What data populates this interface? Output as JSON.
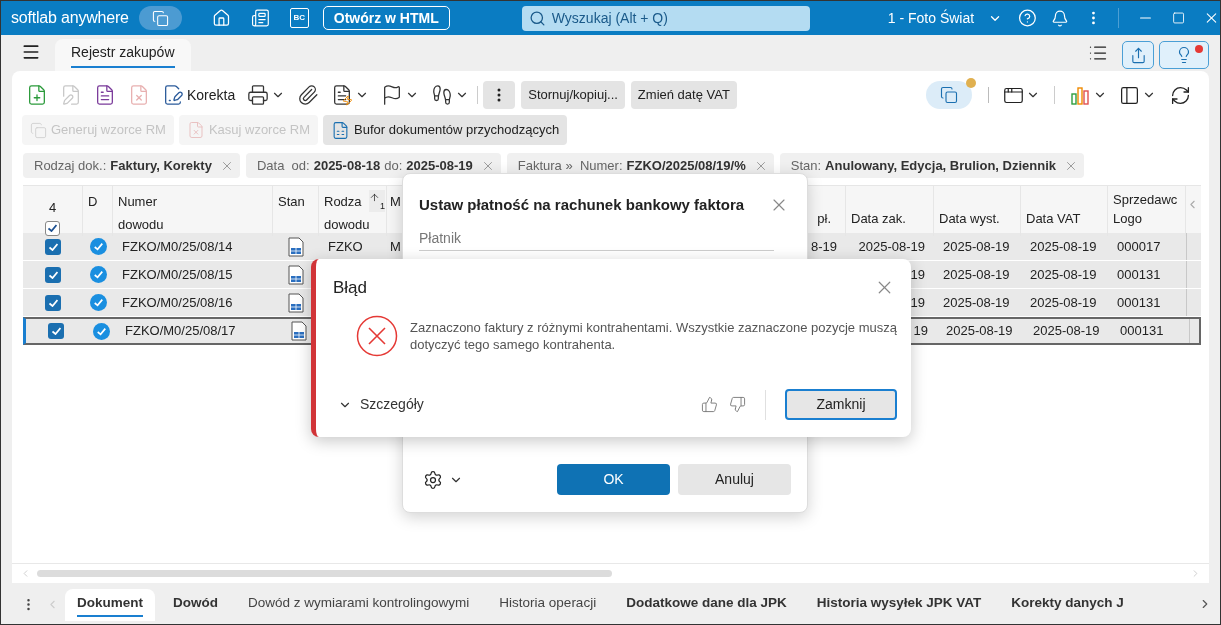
{
  "titlebar": {
    "brand": "softlab anywhere",
    "bc_badge": "BC",
    "open_html_button": "Otwórz w HTML",
    "search": {
      "placeholder": "Wyszukaj (Alt + Q)"
    },
    "company": "1 - Foto Świat"
  },
  "module_tabs": [
    {
      "label": "Rejestr zakupów",
      "selected": true
    }
  ],
  "toolbar": {
    "actions": [
      {
        "disabled": false,
        "dropdown": false
      },
      {
        "disabled": true,
        "dropdown": false
      },
      {
        "disabled": false,
        "dropdown": false
      },
      {
        "disabled": true,
        "dropdown": false
      },
      {
        "label": "Korekta",
        "disabled": false,
        "dropdown": false
      },
      {
        "disabled": false,
        "dropdown": true
      },
      {
        "disabled": false,
        "dropdown": false
      },
      {
        "disabled": false,
        "dropdown": true
      },
      {
        "disabled": false,
        "dropdown": true
      },
      {
        "disabled": false,
        "dropdown": true
      }
    ],
    "text_buttons": [
      "Stornuj/kopiuj...",
      "Zmień datę VAT"
    ],
    "secondary_buttons": [
      {
        "label": "Generuj wzorce RM",
        "disabled": true
      },
      {
        "label": "Kasuj wzorce RM",
        "disabled": true
      },
      {
        "label": "Bufor dokumentów przychodzących",
        "disabled": false
      }
    ]
  },
  "filters": [
    {
      "parts": [
        {
          "text": "Rodzaj dok.:",
          "bold": false
        },
        {
          "text": "Faktury, Korekty",
          "bold": true
        }
      ]
    },
    {
      "parts": [
        {
          "text": "Data  od:",
          "bold": false
        },
        {
          "text": "2025-08-18",
          "bold": true
        },
        {
          "text": "do:",
          "bold": false
        },
        {
          "text": "2025-08-19",
          "bold": true
        }
      ]
    },
    {
      "parts": [
        {
          "text": "Faktura »  Numer:",
          "bold": false
        },
        {
          "text": "FZKO/2025/08/19/%",
          "bold": true
        }
      ]
    },
    {
      "parts": [
        {
          "text": "Stan:",
          "bold": false
        },
        {
          "text": "Anulowany, Edycja, Brulion, Dziennik",
          "bold": true
        }
      ]
    }
  ],
  "table": {
    "selected_count": "4",
    "header_checked": true,
    "columns": [
      {
        "label": "D"
      },
      {
        "label": "Numer dowodu"
      },
      {
        "label": "Stan"
      },
      {
        "label": "Rodza dowodu",
        "sort_rank": "1"
      },
      {
        "label": "M"
      },
      {
        "label": "pł."
      },
      {
        "label": "Data zak."
      },
      {
        "label": "Data wyst."
      },
      {
        "label": "Data VAT"
      },
      {
        "label": "Logo",
        "group": "Sprzedawc"
      }
    ],
    "rows": [
      {
        "checked": true,
        "approved": true,
        "focused": false,
        "number": "FZKO/M0/25/08/14",
        "type": "FZKO",
        "column_6": "M",
        "column_7": "8-19",
        "purchase_date": "2025-08-19",
        "issue_date": "2025-08-19",
        "vat_date": "2025-08-19",
        "logo": "000017"
      },
      {
        "checked": true,
        "approved": true,
        "focused": false,
        "number": "FZKO/M0/25/08/15",
        "purchase_date": "19",
        "issue_date": "2025-08-19",
        "vat_date": "2025-08-19",
        "logo": "000131"
      },
      {
        "checked": true,
        "approved": true,
        "focused": false,
        "number": "FZKO/M0/25/08/16",
        "purchase_date": "19",
        "issue_date": "2025-08-19",
        "vat_date": "2025-08-19",
        "logo": "000131"
      },
      {
        "checked": true,
        "approved": true,
        "focused": true,
        "number": "FZKO/M0/25/08/17",
        "purchase_date": "19",
        "issue_date": "2025-08-19",
        "vat_date": "2025-08-19",
        "logo": "000131"
      }
    ]
  },
  "payment_dialog": {
    "title": "Ustaw płatność na rachunek bankowy faktora",
    "payer_field": {
      "placeholder": "Płatnik"
    },
    "ok_button": "OK",
    "cancel_button": "Anuluj"
  },
  "error_dialog": {
    "title": "Błąd",
    "message": "Zaznaczono faktury z różnymi kontrahentami. Wszystkie zaznaczone pozycje muszą dotyczyć tego samego kontrahenta.",
    "details_label": "Szczegóły",
    "close_button": "Zamknij"
  },
  "bottom_tabs": [
    {
      "label": "Dokument",
      "selected": true,
      "bold": true
    },
    {
      "label": "Dowód",
      "selected": false,
      "bold": true
    },
    {
      "label": "Dowód z wymiarami kontrolingowymi",
      "selected": false,
      "bold": false
    },
    {
      "label": "Historia operacji",
      "selected": false,
      "bold": false
    },
    {
      "label": "Dodatkowe dane dla JPK",
      "selected": false,
      "bold": true
    },
    {
      "label": "Historia wysyłek JPK VAT",
      "selected": false,
      "bold": true
    },
    {
      "label": "Korekty danych J",
      "selected": false,
      "bold": true
    }
  ]
}
